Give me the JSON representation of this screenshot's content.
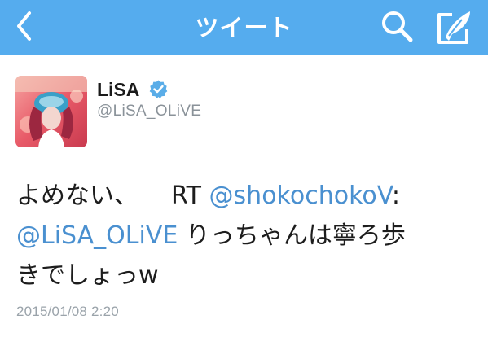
{
  "nav": {
    "title": "ツイート",
    "back_icon": "chevron-left-icon",
    "search_icon": "search-icon",
    "compose_icon": "compose-icon",
    "bar_color": "#55acee"
  },
  "author": {
    "name": "LiSA",
    "handle": "@LiSA_OLiVE",
    "verified": true
  },
  "tweet": {
    "prefix": "よめない、",
    "rt": "RT",
    "mention_1": "@shokochokoV",
    "colon": ":",
    "mention_2": "@LiSA_OLiVE",
    "text_line2": " りっちゃんは寧ろ歩",
    "text_line3": "きでしょっw",
    "mention_color": "#4a90d0"
  },
  "timestamp": "2015/01/08 2:20"
}
